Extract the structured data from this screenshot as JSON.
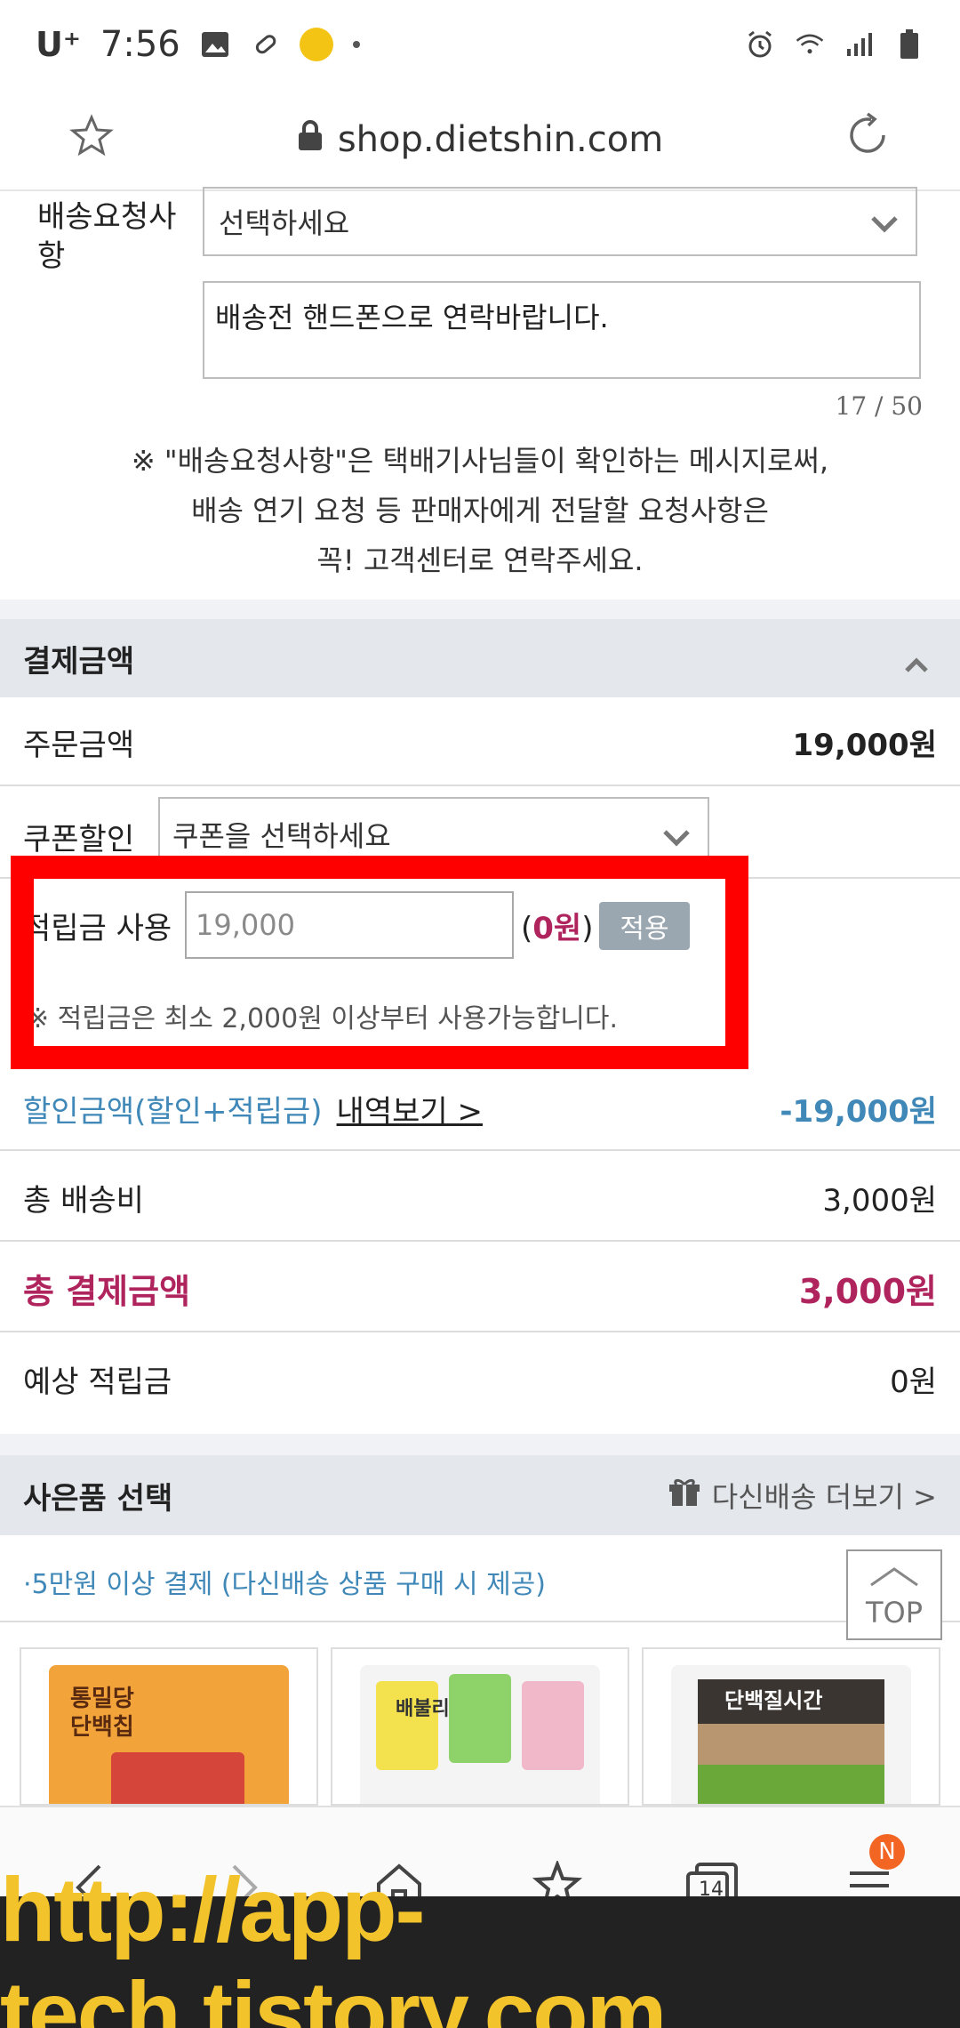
{
  "status_bar": {
    "carrier": "U⁺",
    "time": "7:56"
  },
  "browser": {
    "url": "shop.dietshin.com",
    "tab_count": "14",
    "menu_badge": "N"
  },
  "delivery": {
    "label": "배송요청사항",
    "select_placeholder": "선택하세요",
    "message": "배송전 핸드폰으로 연락바랍니다.",
    "counter": "17 / 50",
    "notice_lines": [
      "※ \"배송요청사항\"은 택배기사님들이 확인하는 메시지로써,",
      "배송 연기 요청 등 판매자에게 전달할 요청사항은",
      "꼭! 고객센터로 연락주세요."
    ]
  },
  "payment": {
    "section_title": "결제금액",
    "order_amount_label": "주문금액",
    "order_amount_value": "19,000원",
    "coupon_label": "쿠폰할인",
    "coupon_placeholder": "쿠폰을 선택하세요",
    "points_label": "적립금 사용",
    "points_input_value": "19,000",
    "points_open": "(",
    "points_applied": "0원",
    "points_close": ")",
    "apply_label": "적용",
    "points_note": "※ 적립금은 최소 2,000원 이상부터 사용가능합니다.",
    "discount_label": "할인금액(할인+적립금)",
    "discount_link": "내역보기 >",
    "discount_value": "-19,000원",
    "shipping_label": "총 배송비",
    "shipping_value": "3,000원",
    "total_label": "총 결제금액",
    "total_value": "3,000원",
    "expected_points_label": "예상 적립금",
    "expected_points_value": "0원"
  },
  "gift": {
    "section_title": "사은품 선택",
    "more_label": "다신배송 더보기 >",
    "condition": "·5만원 이상 결제 (다신배송 상품 구매 시 제공)",
    "top_label": "TOP",
    "products": [
      {
        "line1": "통밀당",
        "line2": "단백칩"
      },
      {
        "line1": "배불리",
        "line2": ""
      },
      {
        "line1": "단백질시간",
        "line2": ""
      }
    ]
  },
  "watermark": "http://app-tech.tistory.com",
  "colors": {
    "accent_magenta": "#b0245d",
    "accent_blue": "#3f88b8",
    "highlight_red": "#ff0000"
  }
}
